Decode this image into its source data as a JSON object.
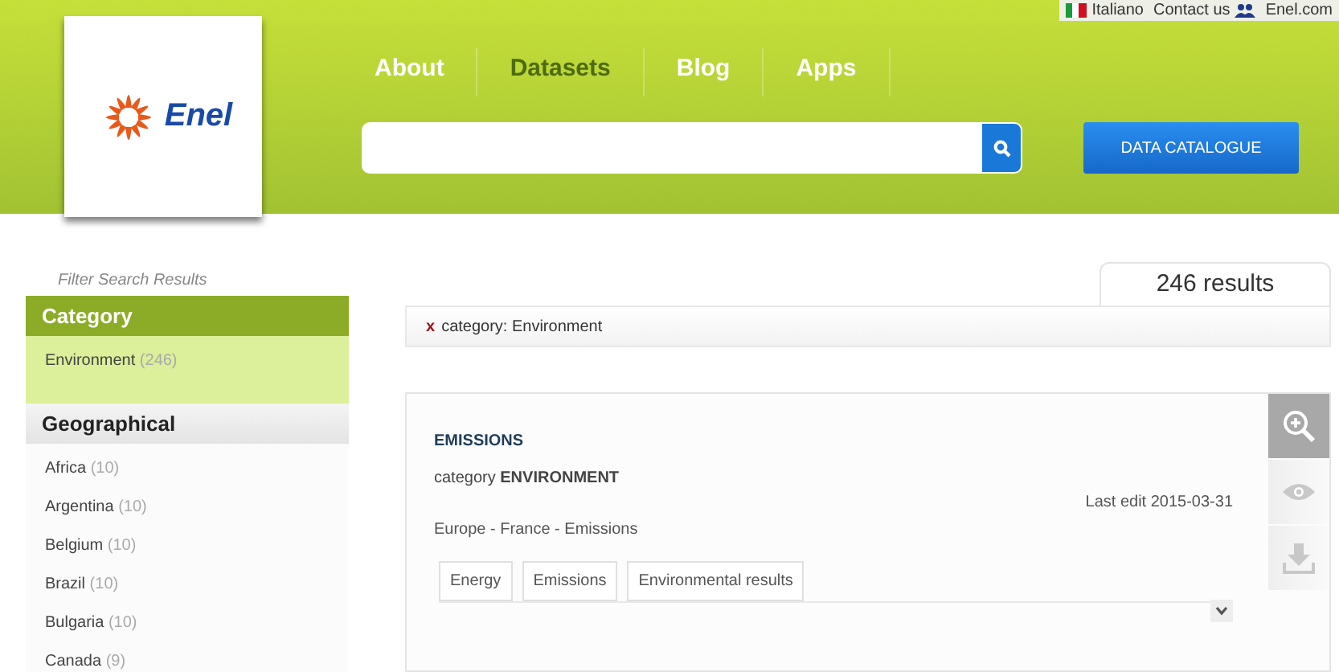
{
  "top_links": [
    {
      "label": "Italiano",
      "kind": "flag"
    },
    {
      "label": "Contact us",
      "kind": "people"
    },
    {
      "label": "Enel.com",
      "kind": "plain"
    }
  ],
  "logo": {
    "text": "Enel"
  },
  "nav": [
    {
      "label": "About",
      "selected": false
    },
    {
      "label": "Datasets",
      "selected": true
    },
    {
      "label": "Blog",
      "selected": false
    },
    {
      "label": "Apps",
      "selected": false
    }
  ],
  "catalogue_button": "DATA CATALOGUE",
  "sidebar": {
    "title": "Filter Search Results",
    "sections": [
      {
        "heading": "Category",
        "expanded": true,
        "items": [
          {
            "label": "Environment",
            "count": "(246)"
          }
        ]
      },
      {
        "heading": "Geographical",
        "expanded": false,
        "items": [
          {
            "label": "Africa",
            "count": "(10)"
          },
          {
            "label": "Argentina",
            "count": "(10)"
          },
          {
            "label": "Belgium",
            "count": "(10)"
          },
          {
            "label": "Brazil",
            "count": "(10)"
          },
          {
            "label": "Bulgaria",
            "count": "(10)"
          },
          {
            "label": "Canada",
            "count": "(9)"
          }
        ]
      }
    ]
  },
  "results_count": "246 results",
  "active_filter": {
    "remove": "x",
    "label": "category: Environment"
  },
  "result": {
    "title": "EMISSIONS",
    "category_label": "category",
    "category": "ENVIRONMENT",
    "last_edit": "Last edit 2015-03-31",
    "path": "Europe - France - Emissions",
    "tags": [
      "Energy",
      "Emissions",
      "Environmental results"
    ]
  }
}
